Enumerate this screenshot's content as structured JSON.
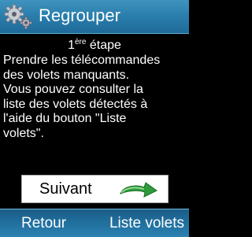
{
  "header": {
    "title": "Regrouper",
    "icon": "gears-icon"
  },
  "content": {
    "step_number": "1",
    "step_suffix": "ère",
    "step_label": "étape",
    "text": "Prendre les télécommandes\ndes volets manquants.\nVous pouvez consulter la\nliste des volets détectés à\nl'aide du bouton \"Liste\nvolets\"."
  },
  "next_button": {
    "label": "Suivant",
    "icon": "green-arrow-icon"
  },
  "softkeys": {
    "left": "Retour",
    "right": "Liste volets"
  },
  "colors": {
    "bar": "#2a7fae",
    "background": "#000000",
    "accent_green": "#2e9a3a"
  }
}
